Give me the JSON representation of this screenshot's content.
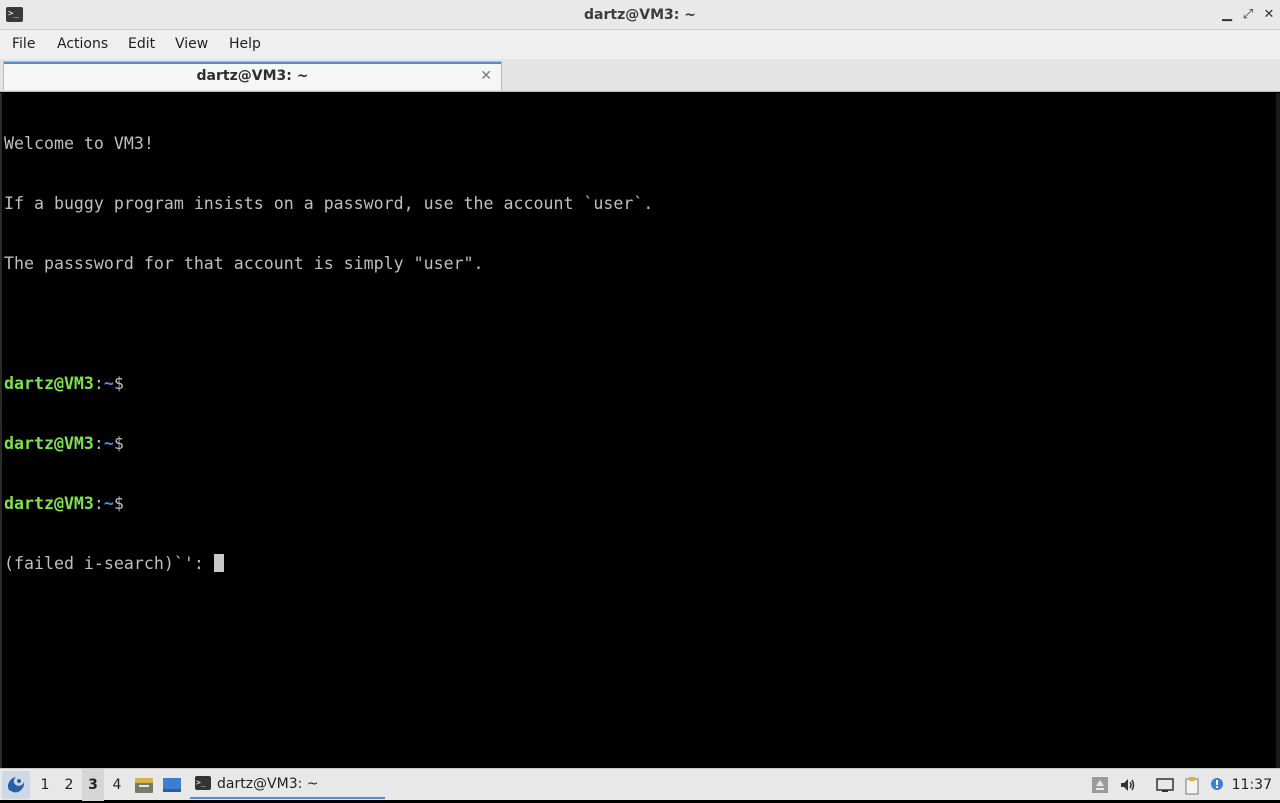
{
  "window": {
    "title": "dartz@VM3: ~",
    "controls": {
      "minimize_icon": "minimize-icon",
      "restore_icon": "restore-icon",
      "close_icon": "close-icon"
    }
  },
  "menu": {
    "items": [
      "File",
      "Actions",
      "Edit",
      "View",
      "Help"
    ]
  },
  "tabs": [
    {
      "label": "dartz@VM3: ~",
      "close_glyph": "✕"
    }
  ],
  "terminal": {
    "banner": [
      "Welcome to VM3!",
      "If a buggy program insists on a password, use the account `user`.",
      "The passsword for that account is simply \"user\".",
      ""
    ],
    "prompts": [
      {
        "user": "dartz@VM3",
        "sep": ":",
        "path": "~",
        "sym": "$"
      },
      {
        "user": "dartz@VM3",
        "sep": ":",
        "path": "~",
        "sym": "$"
      },
      {
        "user": "dartz@VM3",
        "sep": ":",
        "path": "~",
        "sym": "$"
      }
    ],
    "search_line": "(failed i-search)`': ",
    "colors": {
      "user": "#7de34a",
      "path": "#4f8fe6",
      "text": "#bfbfbf",
      "background": "#000000"
    }
  },
  "taskbar": {
    "workspaces": [
      "1",
      "2",
      "3",
      "4"
    ],
    "active_workspace": "3",
    "task_label": "dartz@VM3: ~",
    "clock": "11:37",
    "accent": "#4a90d9"
  }
}
